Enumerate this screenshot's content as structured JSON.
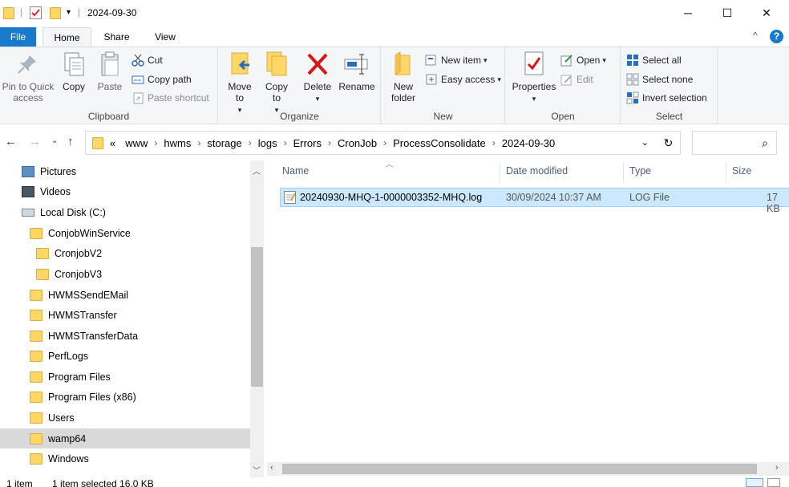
{
  "window": {
    "title": "2024-09-30",
    "minimize": "─",
    "maximize": "☐",
    "close": "✕"
  },
  "ribbon_tabs": {
    "file": "File",
    "home": "Home",
    "share": "Share",
    "view": "View",
    "collapse": "^",
    "help": "?"
  },
  "ribbon": {
    "clipboard": {
      "label": "Clipboard",
      "pin": "Pin to Quick access",
      "copy": "Copy",
      "paste": "Paste",
      "cut": "Cut",
      "copy_path": "Copy path",
      "paste_shortcut": "Paste shortcut"
    },
    "organize": {
      "label": "Organize",
      "move_to": "Move to",
      "copy_to": "Copy to",
      "delete": "Delete",
      "rename": "Rename"
    },
    "new": {
      "label": "New",
      "new_folder": "New folder",
      "new_item": "New item",
      "easy_access": "Easy access"
    },
    "open": {
      "label": "Open",
      "properties": "Properties",
      "open": "Open",
      "edit": "Edit"
    },
    "select": {
      "label": "Select",
      "select_all": "Select all",
      "select_none": "Select none",
      "invert_selection": "Invert selection"
    }
  },
  "address": {
    "overflow": "«",
    "crumbs": [
      "www",
      "hwms",
      "storage",
      "logs",
      "Errors",
      "CronJob",
      "ProcessConsolidate",
      "2024-09-30"
    ]
  },
  "nav_pane": {
    "items": [
      {
        "label": "Pictures",
        "icon": "pictures-icon"
      },
      {
        "label": "Videos",
        "icon": "videos-icon"
      },
      {
        "label": "Local Disk (C:)",
        "icon": "drive-icon"
      },
      {
        "label": "ConjobWinService",
        "icon": "folder-icon"
      },
      {
        "label": "CronjobV2",
        "icon": "folder-icon"
      },
      {
        "label": "CronjobV3",
        "icon": "folder-icon"
      },
      {
        "label": "HWMSSendEMail",
        "icon": "folder-icon"
      },
      {
        "label": "HWMSTransfer",
        "icon": "folder-icon"
      },
      {
        "label": "HWMSTransferData",
        "icon": "folder-icon"
      },
      {
        "label": "PerfLogs",
        "icon": "folder-icon"
      },
      {
        "label": "Program Files",
        "icon": "folder-icon"
      },
      {
        "label": "Program Files (x86)",
        "icon": "folder-icon"
      },
      {
        "label": "Users",
        "icon": "folder-icon"
      },
      {
        "label": "wamp64",
        "icon": "folder-icon"
      },
      {
        "label": "Windows",
        "icon": "folder-icon"
      }
    ]
  },
  "file_list": {
    "columns": {
      "name": "Name",
      "date_modified": "Date modified",
      "type": "Type",
      "size": "Size"
    },
    "rows": [
      {
        "name": "20240930-MHQ-1-0000003352-MHQ.log",
        "date_modified": "30/09/2024 10:37 AM",
        "type": "LOG File",
        "size": "17 KB"
      }
    ]
  },
  "status": {
    "count": "1 item",
    "selected": "1 item selected  16.0 KB"
  },
  "colors": {
    "accent": "#1979ca",
    "selection": "#cce8ff",
    "folder": "#ffd766"
  }
}
